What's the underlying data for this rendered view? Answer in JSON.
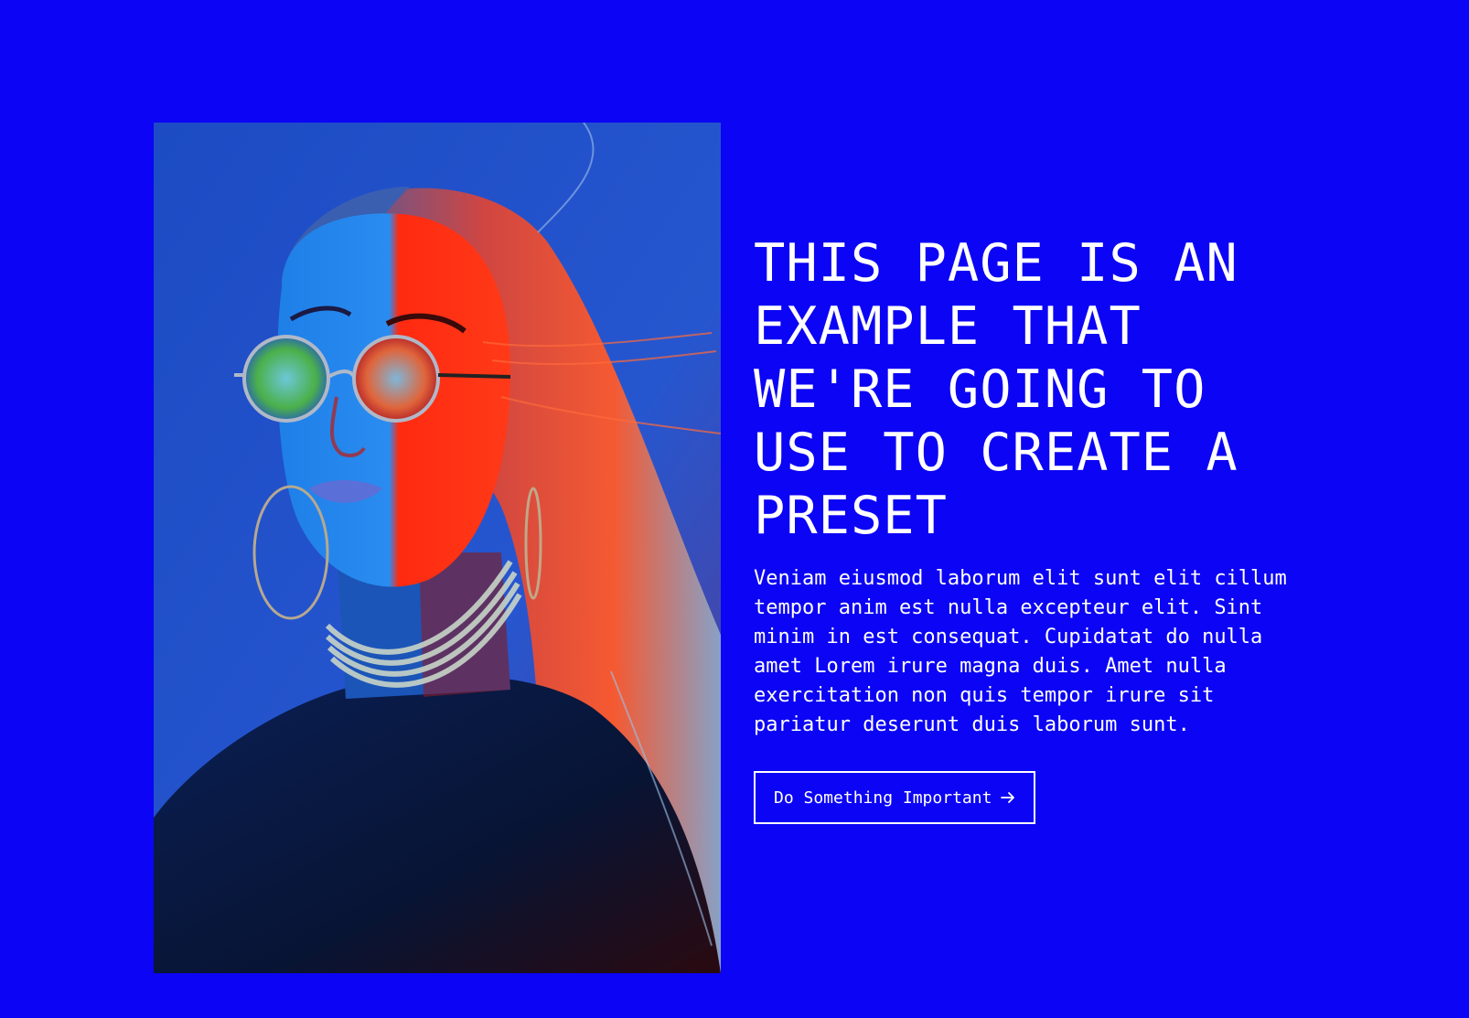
{
  "hero": {
    "title": "THIS PAGE IS AN EXAMPLE THAT WE'RE GOING TO USE TO CREATE A PRESET",
    "body": "Veniam eiusmod laborum elit sunt elit cillum tempor anim est nulla excepteur elit. Sint minim in est consequat. Cupidatat do nulla amet Lorem irure magna duis. Amet nulla exercitation non quis tempor irure sit pariatur deserunt duis laborum sunt.",
    "cta_label": "Do Something Important",
    "cta_icon": "arrow-right-icon",
    "image": "portrait-photo"
  },
  "colors": {
    "background": "#0c04f4",
    "text": "#ffffff",
    "cta_border": "#ffffff"
  }
}
